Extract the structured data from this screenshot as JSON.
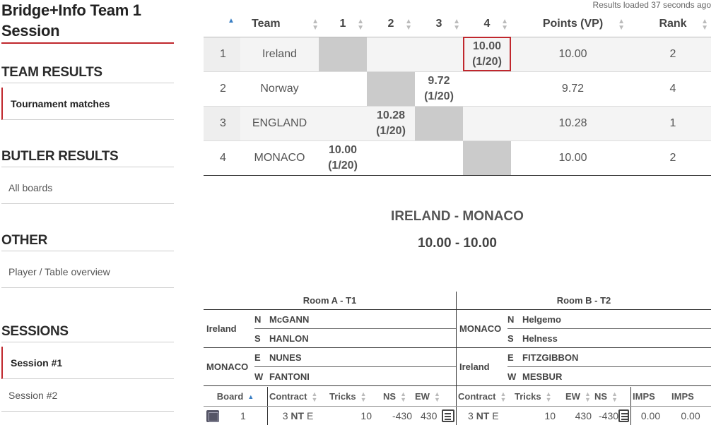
{
  "sidebar": {
    "title_line1": "Bridge+Info Team 1",
    "title_line2": "Session",
    "sections": [
      {
        "heading": "TEAM RESULTS",
        "items": [
          "Tournament matches"
        ]
      },
      {
        "heading": "BUTLER RESULTS",
        "items": [
          "All boards"
        ]
      },
      {
        "heading": "OTHER",
        "items": [
          "Player / Table overview"
        ]
      },
      {
        "heading": "SESSIONS",
        "items": [
          "Session #1",
          "Session #2"
        ]
      }
    ]
  },
  "status": "Results loaded 37 seconds ago",
  "standings": {
    "headers": [
      "Team",
      "1",
      "2",
      "3",
      "4",
      "Points (VP)",
      "Rank"
    ],
    "rows": [
      {
        "num": "1",
        "team": "Ireland",
        "s1": "",
        "s2": "",
        "s3": "",
        "s4": "10.00\n(1/20)",
        "points": "10.00",
        "rank": "2"
      },
      {
        "num": "2",
        "team": "Norway",
        "s1": "",
        "s2": "",
        "s3": "9.72\n(1/20)",
        "s4": "",
        "points": "9.72",
        "rank": "4"
      },
      {
        "num": "3",
        "team": "ENGLAND",
        "s1": "",
        "s2": "10.28\n(1/20)",
        "s3": "",
        "s4": "",
        "points": "10.28",
        "rank": "1"
      },
      {
        "num": "4",
        "team": "MONACO",
        "s1": "10.00\n(1/20)",
        "s2": "",
        "s3": "",
        "s4": "",
        "points": "10.00",
        "rank": "2"
      }
    ]
  },
  "match": {
    "title": "IRELAND - MONACO",
    "score": "10.00 - 10.00"
  },
  "rooms": {
    "a": {
      "title": "Room A - T1",
      "pairs": [
        {
          "team": "Ireland",
          "p1_dir": "N",
          "p1": "McGANN",
          "p2_dir": "S",
          "p2": "HANLON"
        },
        {
          "team": "MONACO",
          "p1_dir": "E",
          "p1": "NUNES",
          "p2_dir": "W",
          "p2": "FANTONI"
        }
      ]
    },
    "b": {
      "title": "Room B - T2",
      "pairs": [
        {
          "team": "MONACO",
          "p1_dir": "N",
          "p1": "Helgemo",
          "p2_dir": "S",
          "p2": "Helness"
        },
        {
          "team": "Ireland",
          "p1_dir": "E",
          "p1": "FITZGIBBON",
          "p2_dir": "W",
          "p2": "MESBUR"
        }
      ]
    }
  },
  "boards": {
    "headers": {
      "board": "Board",
      "contract_a": "Contract",
      "tricks_a": "Tricks",
      "ns_a": "NS",
      "ew_a": "EW",
      "contract_b": "Contract",
      "tricks_b": "Tricks",
      "ew_b": "EW",
      "ns_b": "NS",
      "imps1": "IMPS",
      "imps2": "IMPS"
    },
    "rows": [
      {
        "board": "1",
        "contract_a_level": "3",
        "contract_a_strain": "NT",
        "contract_a_decl": "E",
        "tricks_a": "10",
        "ns_a": "-430",
        "ew_a": "430",
        "contract_b_level": "3",
        "contract_b_strain": "NT",
        "contract_b_decl": "E",
        "tricks_b": "10",
        "ew_b": "430",
        "ns_b": "-430",
        "imps1": "0.00",
        "imps2": "0.00"
      }
    ]
  },
  "icons": {
    "sort": "sort-icon",
    "sort_up": "sort-ascending-icon",
    "doc": "board-details-icon",
    "board": "board-diagram-icon"
  },
  "colors": {
    "accent": "#c0272d",
    "sort_active": "#3a7fc4",
    "grey_cell": "#cbcbcb"
  }
}
